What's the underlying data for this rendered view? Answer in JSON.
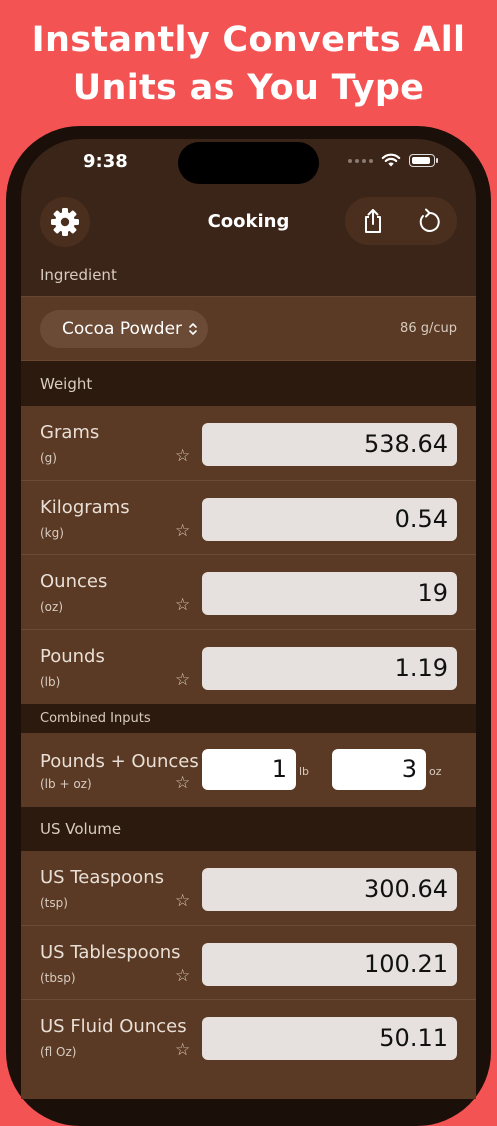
{
  "headline": {
    "line1": "Instantly Converts All",
    "line2": "Units as You Type"
  },
  "status_bar": {
    "time": "9:38"
  },
  "nav": {
    "title": "Cooking",
    "left_icon": "gear-icon",
    "right_icons": [
      "share-icon",
      "reset-icon"
    ]
  },
  "ingredient": {
    "section_label": "Ingredient",
    "selected": "Cocoa Powder",
    "chevron": "⌃⌄",
    "density": "86 g/cup"
  },
  "weight": {
    "section_label": "Weight",
    "rows": [
      {
        "name": "Grams",
        "abbr": "(g)",
        "value": "538.64"
      },
      {
        "name": "Kilograms",
        "abbr": "(kg)",
        "value": "0.54"
      },
      {
        "name": "Ounces",
        "abbr": "(oz)",
        "value": "19"
      },
      {
        "name": "Pounds",
        "abbr": "(lb)",
        "value": "1.19"
      }
    ]
  },
  "combined": {
    "section_label": "Combined Inputs",
    "name": "Pounds + Ounces",
    "abbr": "(lb + oz)",
    "lb_value": "1",
    "lb_unit": "lb",
    "oz_value": "3",
    "oz_unit": "oz"
  },
  "us_volume": {
    "section_label": "US Volume",
    "rows": [
      {
        "name": "US Teaspoons",
        "abbr": "(tsp)",
        "value": "300.64"
      },
      {
        "name": "US Tablespoons",
        "abbr": "(tbsp)",
        "value": "100.21"
      },
      {
        "name": "US Fluid Ounces",
        "abbr": "(fl Oz)",
        "value": "50.11"
      }
    ]
  },
  "star_glyph": "☆",
  "colors": {
    "background": "#F45353",
    "screen": "#3b2518",
    "row": "#5a3a24",
    "section": "#2c1a0f"
  }
}
